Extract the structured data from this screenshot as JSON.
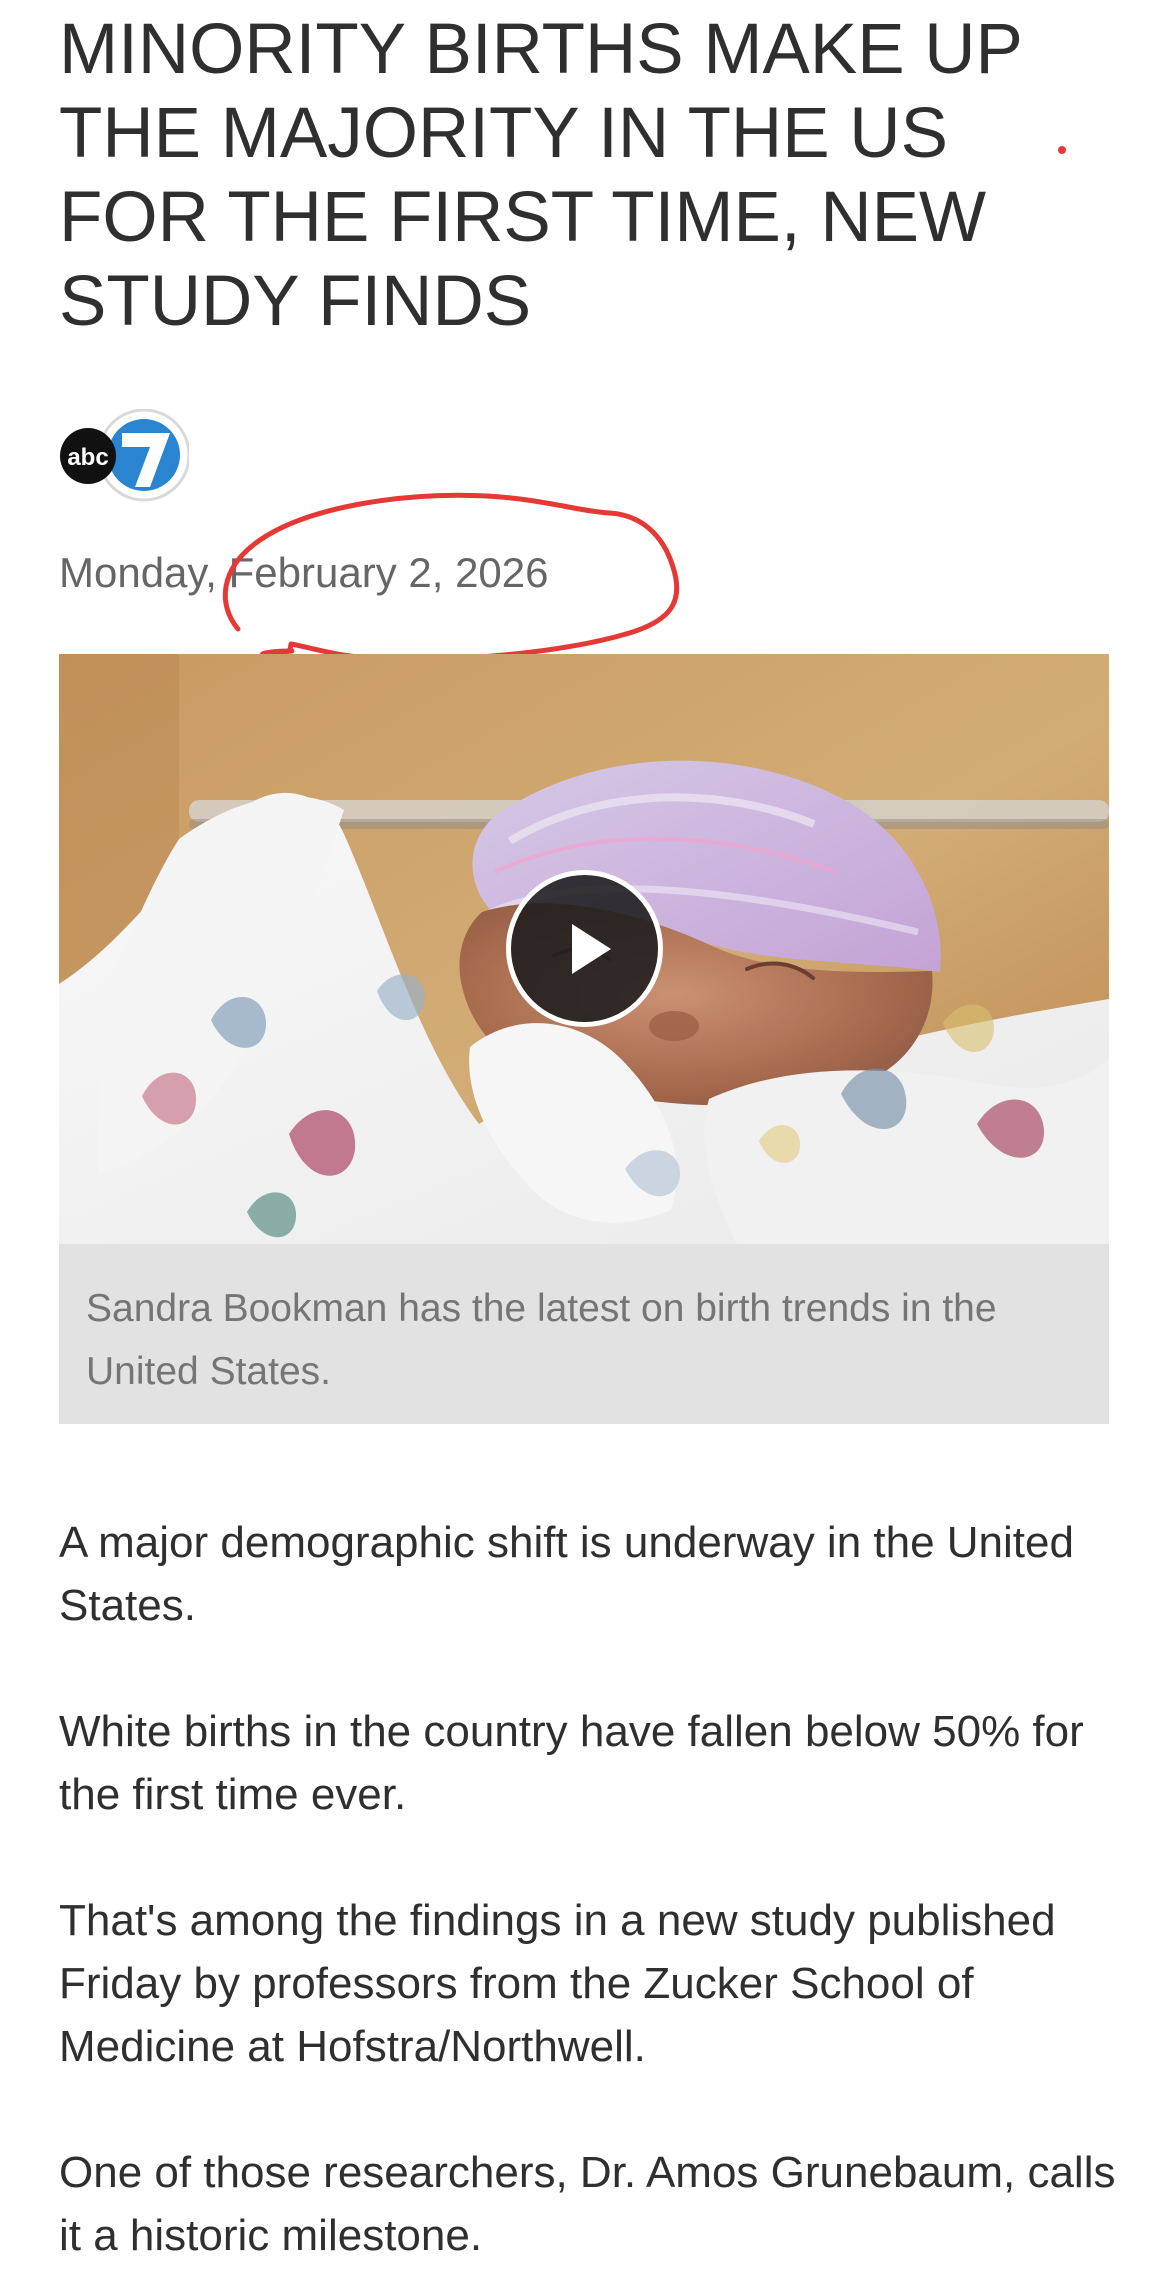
{
  "article": {
    "headline": "MINORITY BIRTHS MAKE UP THE MAJORITY IN THE US FOR THE FIRST TIME, NEW STUDY FINDS",
    "date": "Monday, February 2, 2026",
    "caption": "Sandra Bookman has the latest on birth trends in the United States.",
    "paragraphs": [
      "A major demographic shift is underway in the United States.",
      "White births in the country have fallen below 50% for the first time ever.",
      "That's among the findings in a new study published Friday by professors from the Zucker School of Medicine at Hofstra/Northwell.",
      "One of those researchers, Dr. Amos Grunebaum, calls it a historic milestone."
    ]
  },
  "logo": {
    "name": "abc7-logo",
    "abc_text": "abc",
    "seven_text": "7"
  },
  "video": {
    "play_icon": "play-icon"
  },
  "annotation": {
    "stroke_color": "#e53935"
  },
  "colors": {
    "headline": "#2f2f2f",
    "date": "#666666",
    "caption_background": "#e2e2e2",
    "caption_text": "#757575",
    "body_text": "#2f2f2f",
    "accent_red": "#e53935"
  }
}
